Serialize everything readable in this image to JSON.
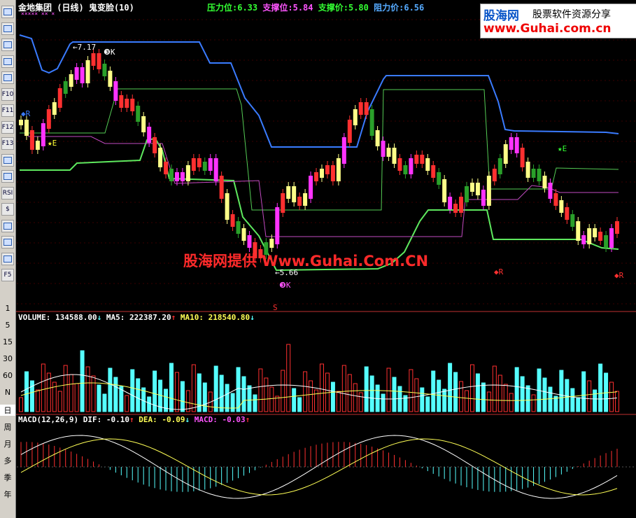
{
  "header": {
    "stock_name": "金地集团",
    "period": "(日线)",
    "indicator": "鬼变脸(10)",
    "pressure_label": "压力位:",
    "pressure_value": "6.33",
    "support_label": "支撑位:",
    "support_value": "5.84",
    "support_price_label": "支撑价:",
    "support_price_value": "5.80",
    "resistance_label": "阻力价:",
    "resistance_value": "6.56"
  },
  "logo": {
    "name": "股海网",
    "tagline": "股票软件资源分享",
    "url": "www.Guhai.com.cn"
  },
  "watermark": "股海网提供 Www.Guhai.Com.CN",
  "price_annotations": {
    "high": "7.17",
    "low": "5.66"
  },
  "signal_labels": {
    "r": "R",
    "k": "K",
    "s": "S",
    "e": "E",
    "k_marker": "K"
  },
  "volume_header": {
    "label": "VOLUME:",
    "value": "134588.00",
    "value_arrow": "↓",
    "ma5_label": "MA5:",
    "ma5_value": "222387.20",
    "ma5_arrow": "↑",
    "ma10_label": "MA10:",
    "ma10_value": "218540.80",
    "ma10_arrow": "↓"
  },
  "macd_header": {
    "label": "MACD(12,26,9)",
    "dif_label": "DIF:",
    "dif_value": "-0.10",
    "dif_arrow": "↑",
    "dea_label": "DEA:",
    "dea_value": "-0.09",
    "dea_arrow": "↓",
    "macd_label": "MACD:",
    "macd_value": "-0.03",
    "macd_arrow": "↑"
  },
  "toolbar": {
    "icon_buttons": [
      "table-icon",
      "grid-icon",
      "line-chart-icon",
      "kline-icon",
      "pages-icon",
      "f10-icon",
      "f11-icon",
      "f12-icon",
      "f13-icon",
      "search-icon",
      "bar-chart-icon",
      "rsi-icon",
      "stock-icon",
      "move-icon",
      "export-icon",
      "pencil-icon",
      "f5-icon"
    ],
    "icon_texts": [
      "",
      "",
      "",
      "",
      "",
      "F10",
      "F11",
      "F12",
      "F13",
      "",
      "",
      "RSI",
      "$",
      "",
      "",
      "",
      "F5"
    ],
    "period_items": [
      "1",
      "5",
      "15",
      "30",
      "60",
      "N",
      "日",
      "周",
      "月",
      "多",
      "季",
      "年"
    ]
  },
  "colors": {
    "resistance_line": "#3a7bff",
    "support_line": "#5ee85e",
    "inner_line": "#55cc55",
    "purple_line": "#c24bc2",
    "up_candle": "#ff3030",
    "yellow_candle": "#ffff88",
    "green_candle": "#2aa02a",
    "magenta_candle": "#ff33ff",
    "volume_down": "#55ffff",
    "macd_dif": "#ffffff",
    "macd_dea": "#ffff55"
  }
}
